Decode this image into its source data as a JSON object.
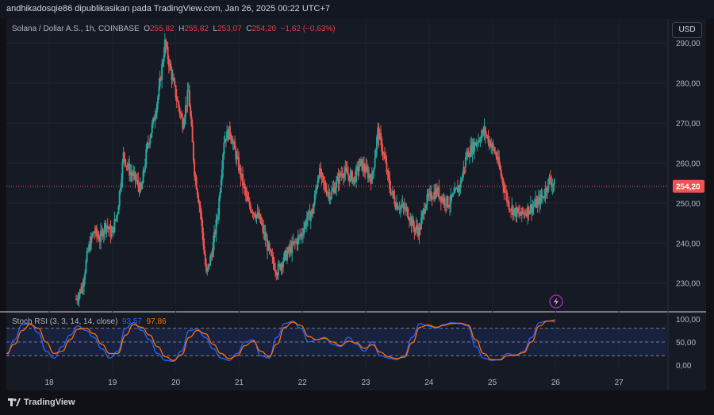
{
  "header": {
    "publisher": "andhikadosqie86 dipublikasikan pada TradingView.com, Jan 26, 2025 00:22 UTC+7"
  },
  "legend": {
    "symbol": "Solana / Dollar A.S., 1h, COINBASE",
    "o_label": "O",
    "o_value": "255,82",
    "h_label": "H",
    "h_value": "255,82",
    "l_label": "L",
    "l_value": "253,07",
    "c_label": "C",
    "c_value": "254,20",
    "change": "−1,62 (−0,63%)"
  },
  "currency_button": "USD",
  "price_axis": {
    "ticks": [
      "290,00",
      "280,00",
      "270,00",
      "260,00",
      "250,00",
      "240,00",
      "230,00"
    ],
    "tick_values": [
      290,
      280,
      270,
      260,
      250,
      240,
      230
    ],
    "current_price_label": "254,20",
    "current_price": 254.2
  },
  "stoch_panel": {
    "label": "Stoch RSI (3, 3, 14, 14, close)",
    "k_value": "93,57",
    "d_value": "97,86",
    "ticks": [
      "100,00",
      "50,00",
      "0,00"
    ],
    "tick_values": [
      100,
      50,
      0
    ]
  },
  "time_axis": {
    "ticks": [
      "18",
      "19",
      "20",
      "21",
      "22",
      "23",
      "24",
      "25",
      "26",
      "27"
    ]
  },
  "brand": {
    "name": "TradingView"
  },
  "colors": {
    "up": "#26a69a",
    "down": "#ef5350",
    "k_line": "#2962ff",
    "d_line": "#ff6d00",
    "background": "#161a25"
  },
  "chart_data": {
    "type": "candlestick",
    "price_ylim": [
      223,
      296
    ],
    "stoch_ylim": [
      0,
      100
    ],
    "day_ticks": [
      "18",
      "19",
      "20",
      "21",
      "22",
      "23",
      "24",
      "25",
      "26",
      "27"
    ],
    "price_path": [
      226,
      229,
      238,
      243,
      241,
      245,
      242,
      248,
      262,
      258,
      256,
      253,
      264,
      270,
      278,
      290,
      283,
      276,
      270,
      278,
      258,
      248,
      232,
      238,
      248,
      266,
      268,
      262,
      256,
      250,
      248,
      246,
      241,
      236,
      233,
      236,
      238,
      240,
      242,
      246,
      248,
      258,
      254,
      252,
      255,
      258,
      257,
      256,
      260,
      258,
      256,
      268,
      262,
      254,
      250,
      249,
      248,
      244,
      243,
      250,
      252,
      253,
      251,
      250,
      252,
      255,
      262,
      264,
      266,
      268,
      265,
      262,
      256,
      250,
      248,
      247,
      248,
      249,
      250,
      252,
      255.8,
      254.2
    ],
    "stoch_k": [
      20,
      55,
      88,
      90,
      70,
      30,
      15,
      40,
      65,
      85,
      75,
      60,
      35,
      15,
      30,
      80,
      92,
      75,
      55,
      25,
      10,
      8,
      30,
      75,
      78,
      60,
      35,
      15,
      10,
      25,
      50,
      55,
      20,
      15,
      60,
      90,
      95,
      80,
      50,
      55,
      60,
      45,
      40,
      60,
      45,
      30,
      50,
      20,
      15,
      12,
      20,
      60,
      90,
      85,
      80,
      88,
      92,
      90,
      85,
      40,
      15,
      10,
      12,
      25,
      20,
      30,
      60,
      92,
      96,
      93.57
    ],
    "stoch_d": [
      25,
      45,
      75,
      88,
      80,
      50,
      25,
      30,
      55,
      78,
      80,
      68,
      45,
      25,
      25,
      65,
      88,
      82,
      65,
      40,
      18,
      10,
      22,
      60,
      75,
      68,
      45,
      25,
      14,
      20,
      42,
      52,
      30,
      18,
      45,
      82,
      93,
      86,
      62,
      55,
      58,
      50,
      42,
      52,
      48,
      36,
      44,
      28,
      18,
      14,
      17,
      48,
      82,
      87,
      82,
      86,
      90,
      91,
      87,
      55,
      25,
      12,
      11,
      20,
      22,
      27,
      50,
      85,
      95,
      97.86
    ]
  }
}
